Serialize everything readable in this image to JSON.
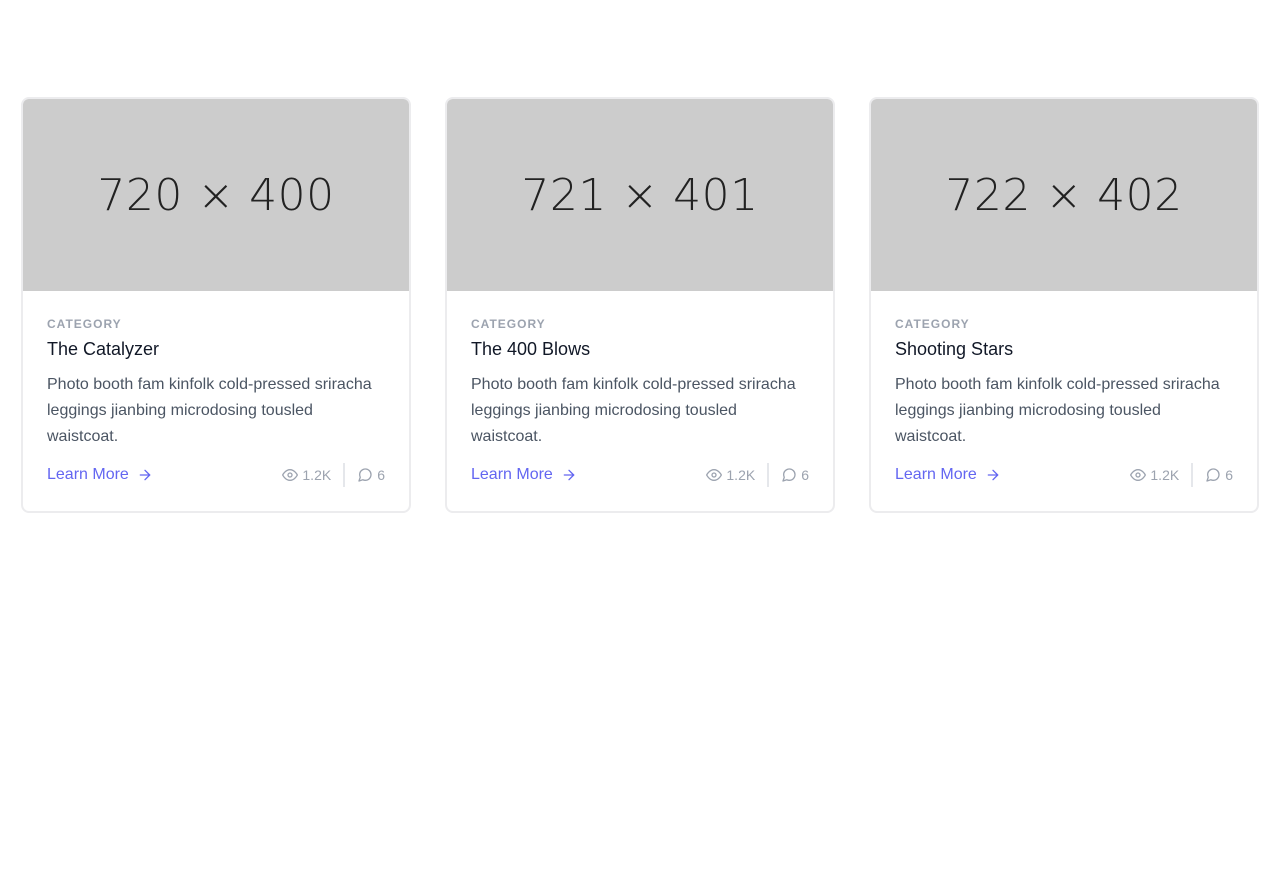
{
  "cards": [
    {
      "image_label": "720 × 400",
      "category": "CATEGORY",
      "title": "The Catalyzer",
      "description": "Photo booth fam kinfolk cold-pressed sriracha leggings jianbing microdosing tousled waistcoat.",
      "link_label": "Learn More",
      "views": "1.2K",
      "comments": "6"
    },
    {
      "image_label": "721 × 401",
      "category": "CATEGORY",
      "title": "The 400 Blows",
      "description": "Photo booth fam kinfolk cold-pressed sriracha leggings jianbing microdosing tousled waistcoat.",
      "link_label": "Learn More",
      "views": "1.2K",
      "comments": "6"
    },
    {
      "image_label": "722 × 402",
      "category": "CATEGORY",
      "title": "Shooting Stars",
      "description": "Photo booth fam kinfolk cold-pressed sriracha leggings jianbing microdosing tousled waistcoat.",
      "link_label": "Learn More",
      "views": "1.2K",
      "comments": "6"
    }
  ],
  "icons": {
    "link": "arrow-right-icon",
    "views": "eye-icon",
    "comments": "chat-bubble-icon"
  },
  "colors": {
    "accent": "#6366f1",
    "placeholder_bg": "#cccccc",
    "muted": "#9ca3af"
  }
}
